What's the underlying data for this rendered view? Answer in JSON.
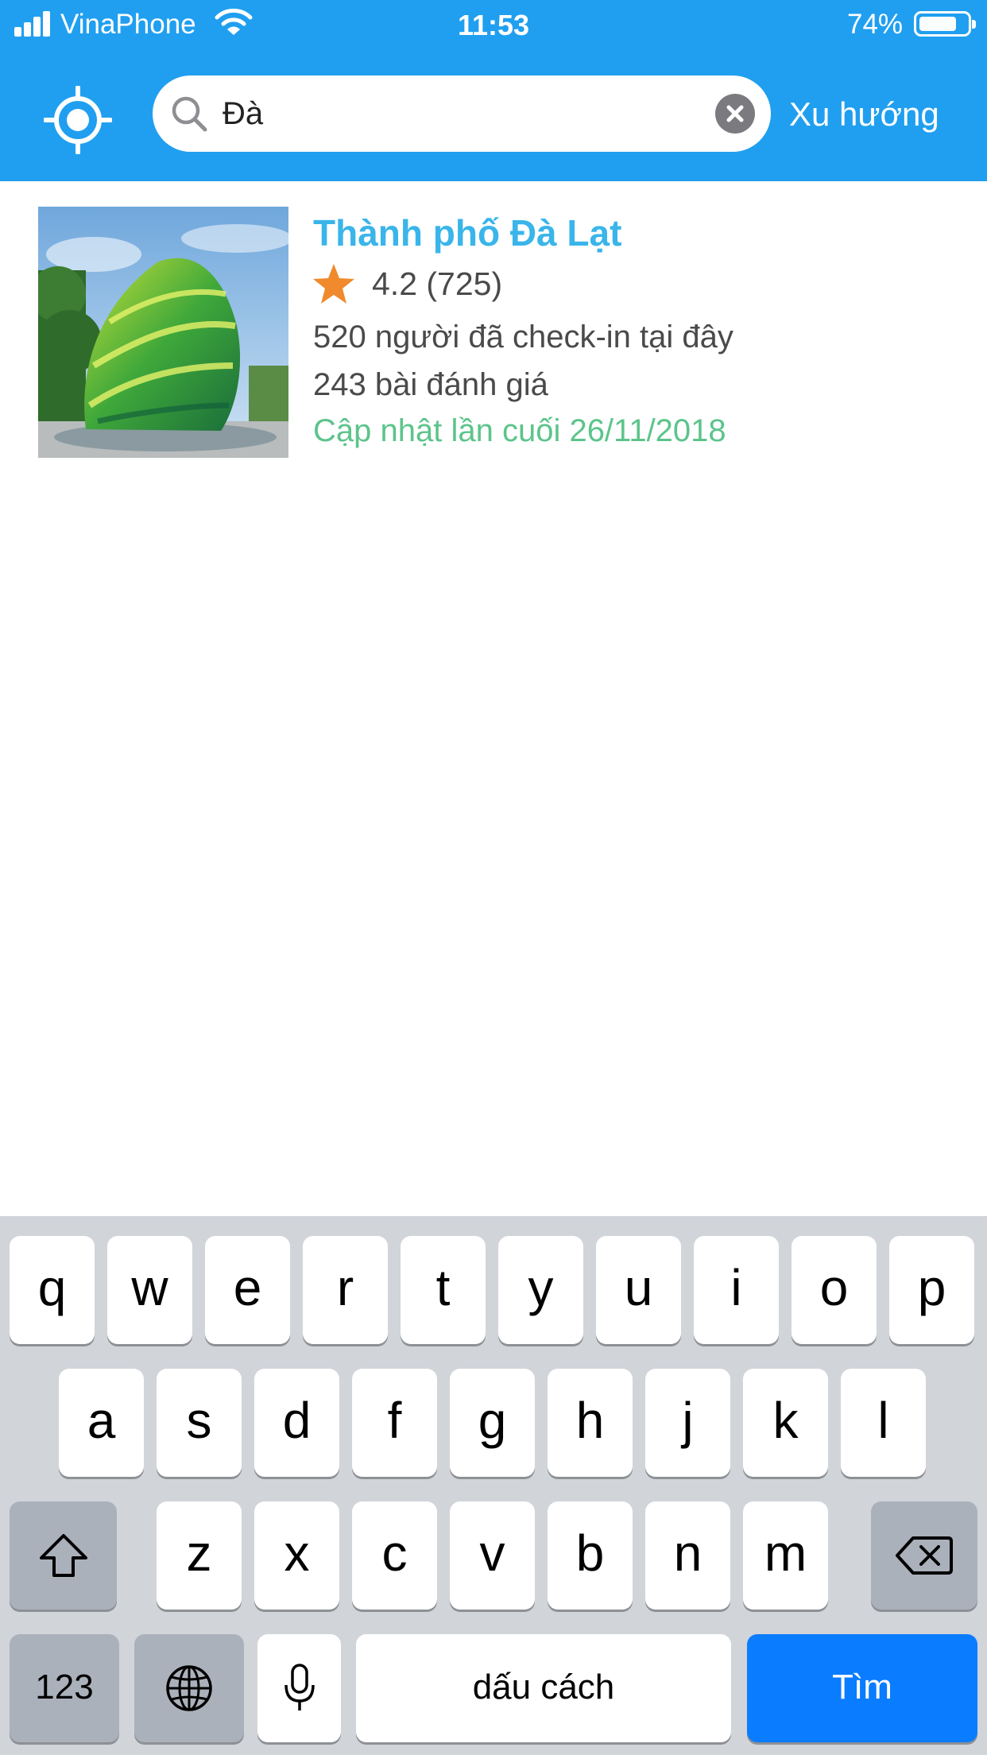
{
  "status_bar": {
    "carrier": "VinaPhone",
    "time": "11:53",
    "battery_percent": "74%",
    "battery_level": 0.74
  },
  "search": {
    "query": "Đà",
    "trend_label": "Xu hướng"
  },
  "results": [
    {
      "title": "Thành phố Đà Lạt",
      "rating": "4.2 (725)",
      "checkins": "520 người đã check-in tại đây",
      "reviews": "243 bài đánh giá",
      "updated": "Cập nhật lần cuối 26/11/2018"
    }
  ],
  "keyboard": {
    "row1": [
      "q",
      "w",
      "e",
      "r",
      "t",
      "y",
      "u",
      "i",
      "o",
      "p"
    ],
    "row2": [
      "a",
      "s",
      "d",
      "f",
      "g",
      "h",
      "j",
      "k",
      "l"
    ],
    "row3": [
      "z",
      "x",
      "c",
      "v",
      "b",
      "n",
      "m"
    ],
    "numbers_label": "123",
    "space_label": "dấu cách",
    "action_label": "Tìm"
  },
  "colors": {
    "header_bg": "#209ff0",
    "title": "#3ab5ea",
    "update_text": "#5cc48b",
    "star": "#f08a2c",
    "action_key": "#0a7cff"
  },
  "icons": [
    "locate-icon",
    "search-icon",
    "clear-icon",
    "star-icon",
    "shift-icon",
    "backspace-icon",
    "globe-icon",
    "mic-icon",
    "wifi-icon",
    "battery-icon"
  ]
}
